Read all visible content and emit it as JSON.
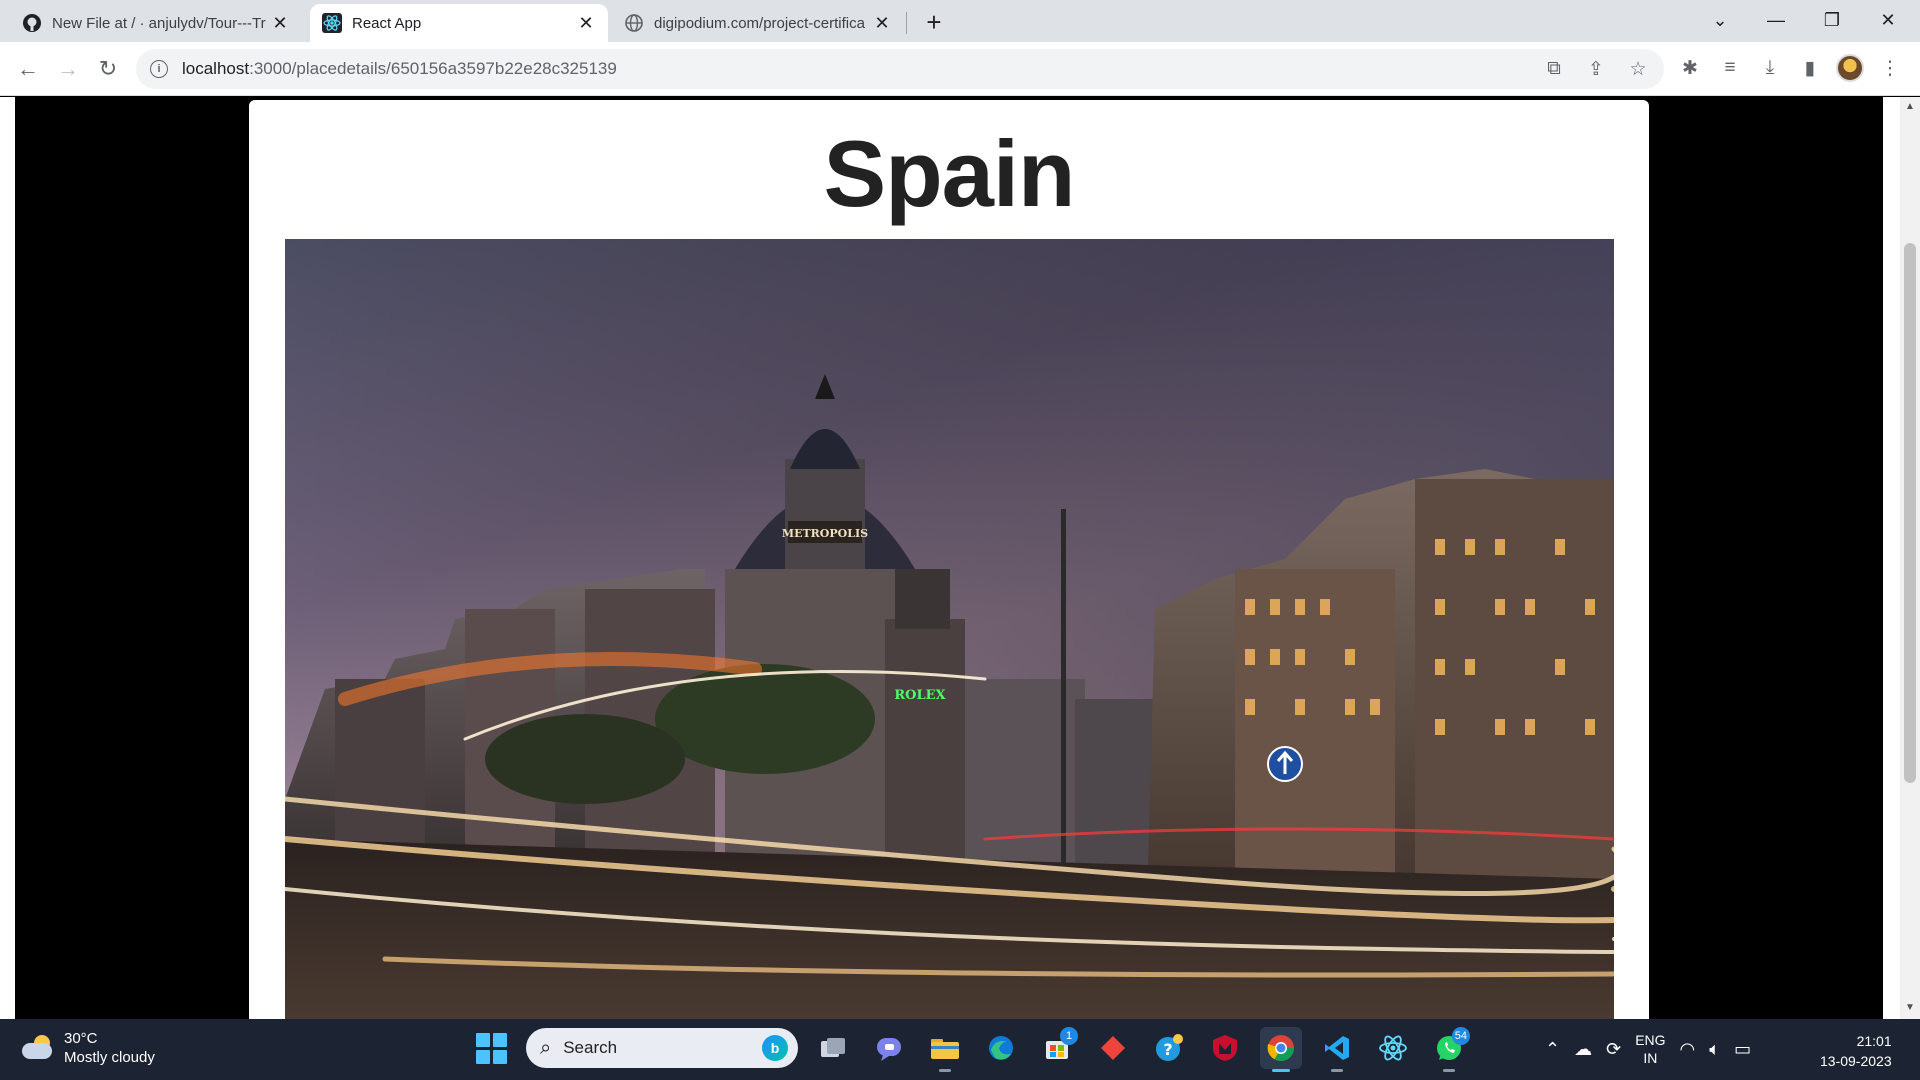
{
  "browser": {
    "tabs": [
      {
        "title": "New File at / · anjulydv/Tour---Tr",
        "icon": "github-icon"
      },
      {
        "title": "React App",
        "icon": "react-icon",
        "active": true
      },
      {
        "title": "digipodium.com/project-certifica",
        "icon": "globe-icon"
      }
    ],
    "url_host": "localhost",
    "url_path": ":3000/placedetails/650156a3597b22e28c325139"
  },
  "page": {
    "place_title": "Spain",
    "image_signs": [
      "METROPOLIS",
      "ROLEX"
    ]
  },
  "taskbar": {
    "weather_temp": "30°C",
    "weather_desc": "Mostly cloudy",
    "search_placeholder": "Search",
    "store_badge": "1",
    "whatsapp_badge": "54",
    "language": "ENG",
    "region": "IN",
    "time": "21:01",
    "date": "13-09-2023"
  },
  "colors": {
    "tabstrip": "#dee1e6",
    "page_background": "#000000",
    "card_background": "#ffffff",
    "taskbar": "#1c2434"
  }
}
